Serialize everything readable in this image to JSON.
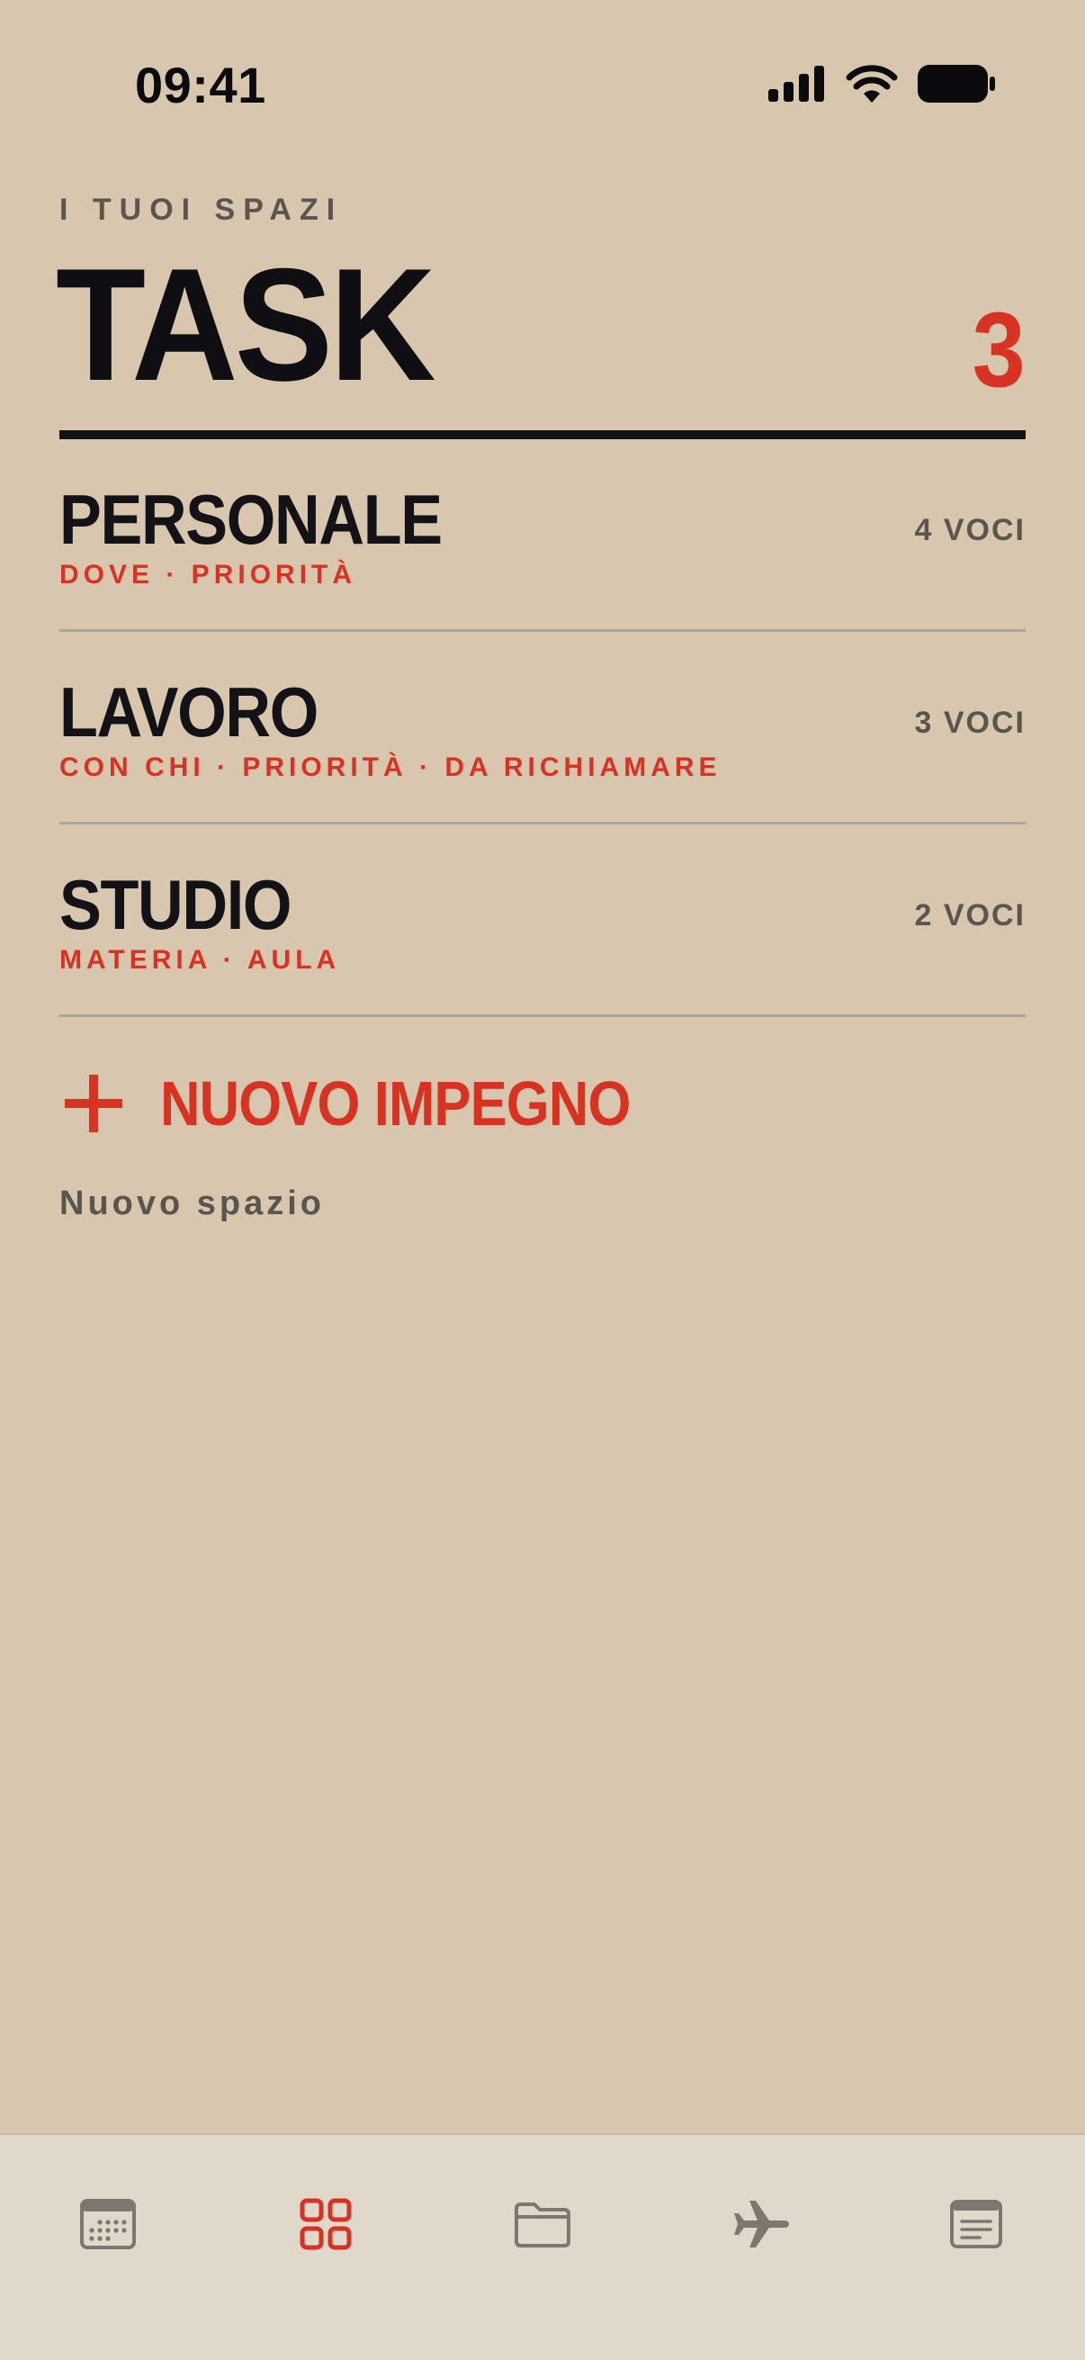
{
  "status_bar": {
    "time": "09:41"
  },
  "header": {
    "eyebrow": "I TUOI SPAZI",
    "title": "TASK",
    "count": "3"
  },
  "spaces": [
    {
      "name": "PERSONALE",
      "tags": "DOVE · PRIORITÀ",
      "count": "4 VOCI"
    },
    {
      "name": "LAVORO",
      "tags": "CON CHI · PRIORITÀ · DA RICHIAMARE",
      "count": "3 VOCI"
    },
    {
      "name": "STUDIO",
      "tags": "MATERIA · AULA",
      "count": "2 VOCI"
    }
  ],
  "actions": {
    "new_commitment": "NUOVO IMPEGNO",
    "new_space": "Nuovo spazio"
  },
  "tab_bar": {
    "tabs": [
      {
        "icon": "calendar-icon",
        "active": false
      },
      {
        "icon": "grid-icon",
        "active": true
      },
      {
        "icon": "folder-icon",
        "active": false
      },
      {
        "icon": "airplane-icon",
        "active": false
      },
      {
        "icon": "notes-icon",
        "active": false
      }
    ]
  },
  "colors": {
    "background": "#d8c7ae",
    "accent": "#d83222",
    "ink": "#121217",
    "muted": "#5a554e",
    "tab_bar": "#e0d8ca",
    "tab_inactive": "#7d7770"
  }
}
